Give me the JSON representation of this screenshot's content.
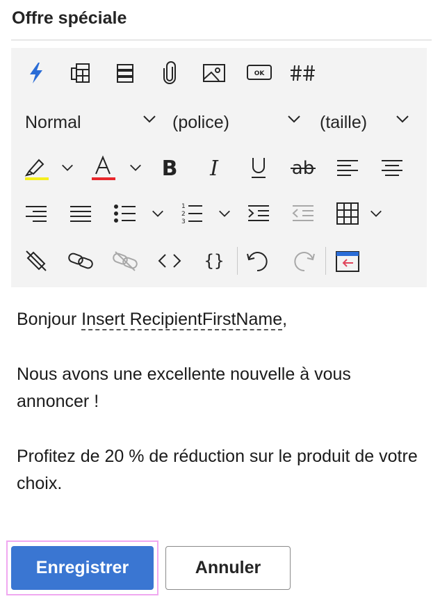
{
  "header": {
    "title": "Offre spéciale"
  },
  "toolbar": {
    "format_value": "Normal",
    "font_value": "(police)",
    "size_value": "(taille)",
    "colors": {
      "highlight": "#f5ee1e",
      "font": "#e8262b",
      "accent_blue": "#2a6cd6",
      "accent_red": "#e0435a"
    },
    "icons": [
      "lightning-icon",
      "layout-icon",
      "section-icon",
      "attachment-icon",
      "image-icon",
      "button-icon",
      "hashtag-icon",
      "highlight-icon",
      "font-color-icon",
      "bold-icon",
      "italic-icon",
      "underline-icon",
      "strikethrough-icon",
      "align-left-icon",
      "align-center-icon",
      "align-right-icon",
      "justify-icon",
      "bullet-list-icon",
      "numbered-list-icon",
      "indent-icon",
      "outdent-icon",
      "table-icon",
      "clear-format-icon",
      "link-icon",
      "unlink-icon",
      "code-icon",
      "braces-icon",
      "undo-icon",
      "redo-icon",
      "insert-form-icon"
    ]
  },
  "content": {
    "greeting_prefix": "Bonjour ",
    "merge_field": "Insert RecipientFirstName",
    "greeting_suffix": ",",
    "paragraph_1": "Nous avons une excellente nouvelle à vous annoncer !",
    "paragraph_2": "Profitez de 20 % de réduction sur le produit de votre choix."
  },
  "actions": {
    "save_label": "Enregistrer",
    "cancel_label": "Annuler"
  }
}
